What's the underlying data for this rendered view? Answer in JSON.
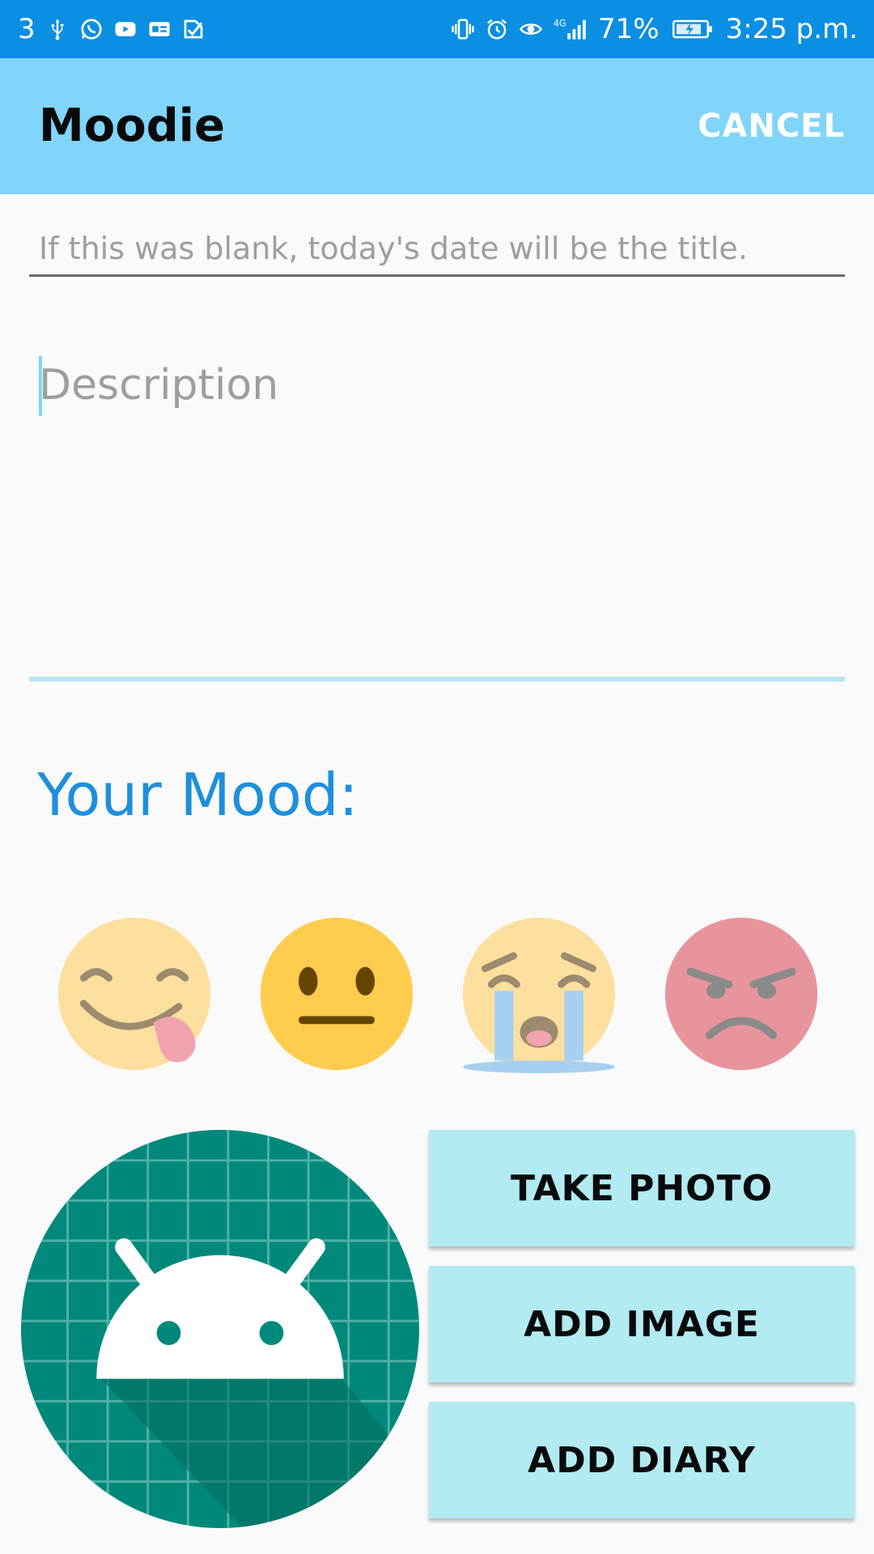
{
  "status_bar": {
    "notification_count": "3",
    "battery": "71%",
    "time": "3:25 p.m.",
    "network": "4G",
    "left_icons": [
      "usb-icon",
      "whatsapp-icon",
      "youtube-icon",
      "ge-icon",
      "check-icon"
    ],
    "right_icons": [
      "vibrate-icon",
      "alarm-icon",
      "eye-icon",
      "signal-icon",
      "battery-icon"
    ],
    "color": "#0b8fe3"
  },
  "app_bar": {
    "title": "Moodie",
    "cancel_label": "CANCEL",
    "color": "#81d4fa"
  },
  "form": {
    "title_placeholder": "If this was blank, today's date will be the title.",
    "title_value": "",
    "description_placeholder": "Description",
    "description_value": ""
  },
  "mood": {
    "heading": "Your Mood:",
    "options": [
      "savoring-face-emoji",
      "neutral-face-emoji",
      "crying-face-emoji",
      "angry-face-emoji"
    ],
    "accent": "#1e8fdc"
  },
  "image": {
    "icon": "android-icon"
  },
  "actions": {
    "take_photo": "TAKE PHOTO",
    "add_image": "ADD IMAGE",
    "add_diary": "ADD DIARY",
    "color": "#b2ebf2"
  }
}
